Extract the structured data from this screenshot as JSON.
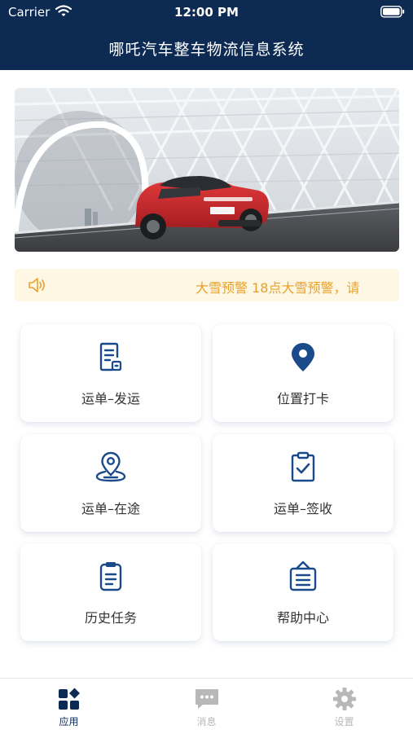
{
  "status_bar": {
    "carrier": "Carrier",
    "time": "12:00 PM"
  },
  "header": {
    "title": "哪吒汽车整车物流信息系统"
  },
  "notice": {
    "text": "大雪预警 18点大雪预警，请"
  },
  "grid": [
    {
      "label": "运单–发运",
      "icon": "document-icon"
    },
    {
      "label": "位置打卡",
      "icon": "location-pin-icon"
    },
    {
      "label": "运单–在途",
      "icon": "map-pin-icon"
    },
    {
      "label": "运单–签收",
      "icon": "clipboard-check-icon"
    },
    {
      "label": "历史任务",
      "icon": "clipboard-list-icon"
    },
    {
      "label": "帮助中心",
      "icon": "help-board-icon"
    }
  ],
  "tabbar": [
    {
      "label": "应用",
      "icon": "apps-icon",
      "active": true
    },
    {
      "label": "消息",
      "icon": "message-icon",
      "active": false
    },
    {
      "label": "设置",
      "icon": "gear-icon",
      "active": false
    }
  ],
  "colors": {
    "brand": "#0c2a52",
    "icon": "#1b4a8a",
    "notice_text": "#e8a22c",
    "notice_bg": "#fdf7e4",
    "inactive": "#b8b8b8"
  }
}
